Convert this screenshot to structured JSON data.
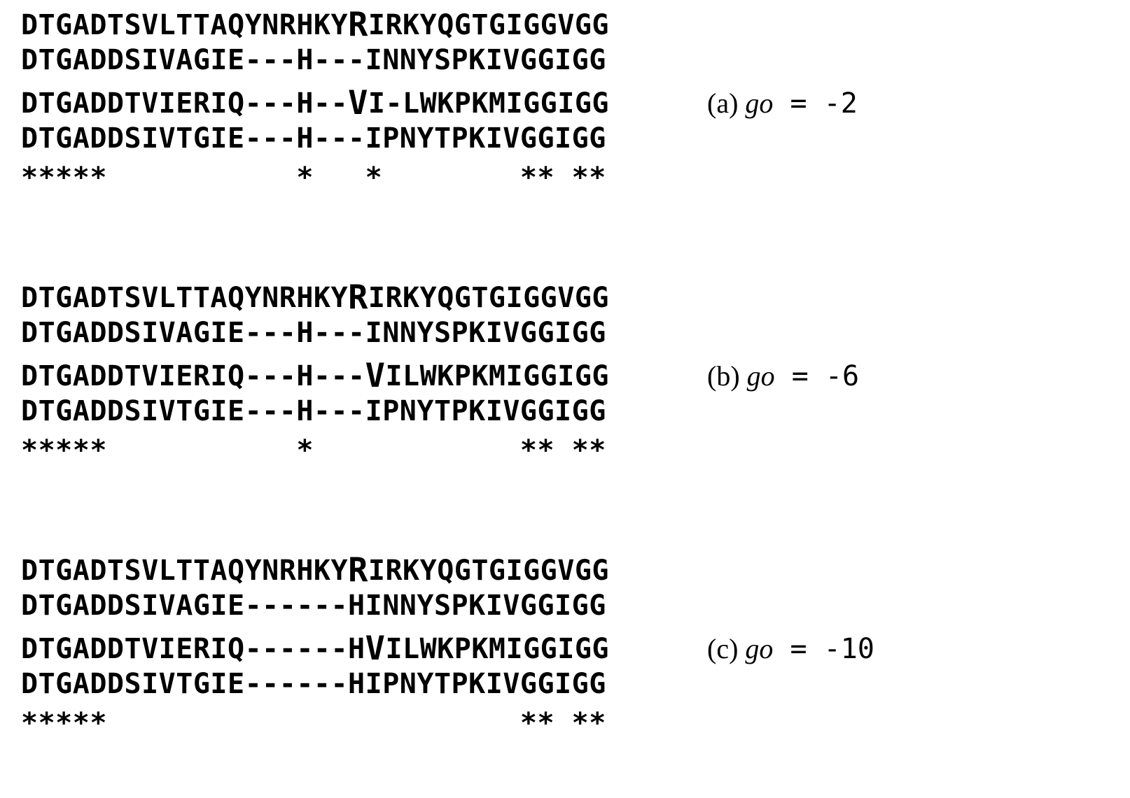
{
  "blocks": [
    {
      "label_letter": "(a)",
      "go_var": "go",
      "go_eq": " = -2",
      "seq1": {
        "pre": "DTGADTSVLTTAQYNRHKY",
        "bold": "R",
        "post": "IRKYQGTGIGGVGG"
      },
      "seq2": {
        "pre": "DTGADDSIVAGIE---H---INNYSPKIVGGIGG",
        "bold": "",
        "post": ""
      },
      "seq3": {
        "pre": "DTGADDTVIERIQ---H--",
        "bold": "V",
        "post": "I-LWKPKMIGGIGG"
      },
      "seq4": {
        "pre": "DTGADDSIVTGIE---H---IPNYTPKIVGGIGG",
        "bold": "",
        "post": ""
      },
      "stars": "*****           *   *        ** **"
    },
    {
      "label_letter": "(b)",
      "go_var": "go",
      "go_eq": " = -6",
      "seq1": {
        "pre": "DTGADTSVLTTAQYNRHKY",
        "bold": "R",
        "post": "IRKYQGTGIGGVGG"
      },
      "seq2": {
        "pre": "DTGADDSIVAGIE---H---INNYSPKIVGGIGG",
        "bold": "",
        "post": ""
      },
      "seq3": {
        "pre": "DTGADDTVIERIQ---H---",
        "bold": "V",
        "post": "ILWKPKMIGGIGG"
      },
      "seq4": {
        "pre": "DTGADDSIVTGIE---H---IPNYTPKIVGGIGG",
        "bold": "",
        "post": ""
      },
      "stars": "*****           *            ** **"
    },
    {
      "label_letter": "(c)",
      "go_var": "go",
      "go_eq": " = -10",
      "seq1": {
        "pre": "DTGADTSVLTTAQYNRHKY",
        "bold": "R",
        "post": "IRKYQGTGIGGVGG"
      },
      "seq2": {
        "pre": "DTGADDSIVAGIE------HINNYSPKIVGGIGG",
        "bold": "",
        "post": ""
      },
      "seq3": {
        "pre": "DTGADDTVIERIQ------H",
        "bold": "V",
        "post": "ILWKPKMIGGIGG"
      },
      "seq4": {
        "pre": "DTGADDSIVTGIE------HIPNYTPKIVGGIGG",
        "bold": "",
        "post": ""
      },
      "stars": "*****                        ** **"
    }
  ],
  "chart_data": {
    "type": "table",
    "title": "Multiple sequence alignments under different gap-opening penalties (go)",
    "panels": [
      {
        "panel": "a",
        "gap_open_penalty": -2,
        "alignment": [
          "DTGADTSVLTTAQYNRHKYRIRKYQGTGIGGVGG",
          "DTGADDSIVAGIE---H---INNYSPKIVGGIGG",
          "DTGADDTVIERIQ---H--VI-LWKPKMIGGIGG",
          "DTGADDSIVTGIE---H---IPNYTPKIVGGIGG"
        ],
        "conservation_marks": "*****           *   *        ** **",
        "highlighted_residues": [
          {
            "row": 1,
            "column_1based": 20,
            "residue": "R"
          },
          {
            "row": 3,
            "column_1based": 20,
            "residue": "V"
          }
        ]
      },
      {
        "panel": "b",
        "gap_open_penalty": -6,
        "alignment": [
          "DTGADTSVLTTAQYNRHKYRIRKYQGTGIGGVGG",
          "DTGADDSIVAGIE---H---INNYSPKIVGGIGG",
          "DTGADDTVIERIQ---H---VILWKPKMIGGIGG",
          "DTGADDSIVTGIE---H---IPNYTPKIVGGIGG"
        ],
        "conservation_marks": "*****           *            ** **",
        "highlighted_residues": [
          {
            "row": 1,
            "column_1based": 20,
            "residue": "R"
          },
          {
            "row": 3,
            "column_1based": 21,
            "residue": "V"
          }
        ]
      },
      {
        "panel": "c",
        "gap_open_penalty": -10,
        "alignment": [
          "DTGADTSVLTTAQYNRHKYRIRKYQGTGIGGVGG",
          "DTGADDSIVAGIE------HINNYSPKIVGGIGG",
          "DTGADDTVIERIQ------HVILWKPKMIGGIGG",
          "DTGADDSIVTGIE------HIPNYTPKIVGGIGG"
        ],
        "conservation_marks": "*****                        ** **",
        "highlighted_residues": [
          {
            "row": 1,
            "column_1based": 20,
            "residue": "R"
          },
          {
            "row": 3,
            "column_1based": 21,
            "residue": "V"
          }
        ]
      }
    ]
  }
}
